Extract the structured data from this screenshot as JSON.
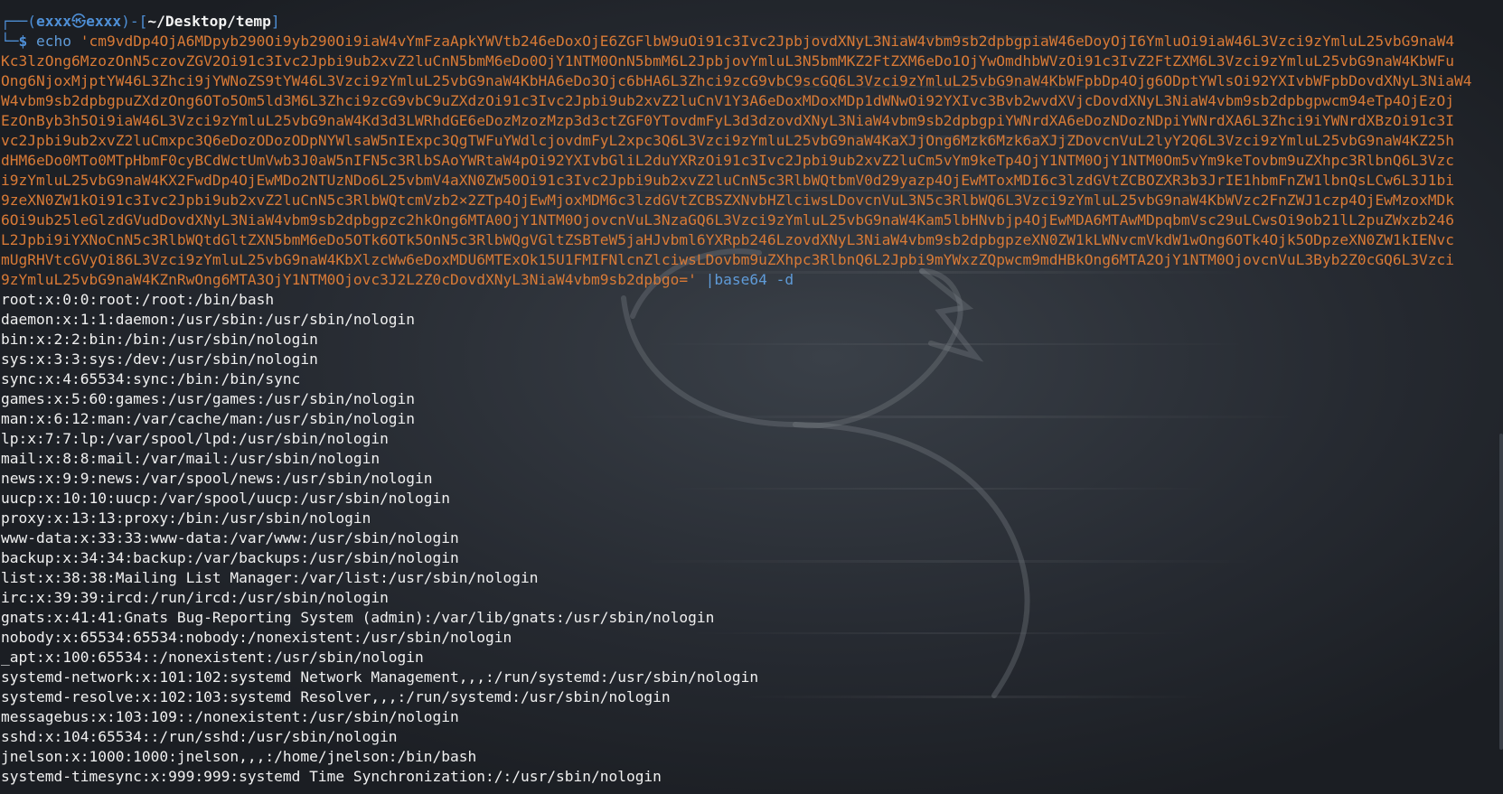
{
  "prompt": {
    "corner_top": "┌──(",
    "user": "exxx",
    "at_symbol": "㉿",
    "host": "exxx",
    "mid": ")-[",
    "cwd": "~/Desktop/temp",
    "end_bracket": "]",
    "corner_bottom": "└─",
    "dollar": "$"
  },
  "command": {
    "echo": "echo",
    "base64_lines": [
      "'cm9vdDp4OjA6MDpyb290Oi9yb290Oi9iaW4vYmFzaApkYWVtb246eDoxOjE6ZGFlbW9uOi91c3Ivc2JpbjovdXNyL3NiaW4vbm9sb2dpbgpiaW46eDoyOjI6YmluOi9iaW46L3Vzci9zYmluL25vbG9naW4",
      "Kc3lzOng6MzozOnN5czovZGV2Oi91c3Ivc2Jpbi9ub2xvZ2luCnN5bmM6eDo0OjY1NTM0OnN5bmM6L2JpbjovYmluL3N5bmMKZ2FtZXM6eDo1OjYwOmdhbWVzOi91c3IvZ2FtZXM6L3Vzci9zYmluL25vbG9naW4KbWFu",
      "Ong6NjoxMjptYW46L3Zhci9jYWNoZS9tYW46L3Vzci9zYmluL25vbG9naW4KbHA6eDo3Ojc6bHA6L3Zhci9zcG9vbC9scGQ6L3Vzci9zYmluL25vbG9naW4KbWFpbDp4Ojg6ODptYWlsOi92YXIvbWFpbDovdXNyL3NiaW4",
      "W4vbm9sb2dpbgpuZXdzOng6OTo5Om5ld3M6L3Zhci9zcG9vbC9uZXdzOi91c3Ivc2Jpbi9ub2xvZ2luCnV1Y3A6eDoxMDoxMDp1dWNwOi92YXIvc3Bvb2wvdXVjcDovdXNyL3NiaW4vbm9sb2dpbgpwcm94eTp4OjEzOj",
      "EzOnByb3h5Oi9iaW46L3Vzci9zYmluL25vbG9naW4Kd3d3LWRhdGE6eDozMzozMzp3d3ctZGF0YTovdmFyL3d3dzovdXNyL3NiaW4vbm9sb2dpbgpiYWNrdXA6eDozNDozNDpiYWNrdXA6L3Zhci9iYWNrdXBzOi91c3I",
      "vc2Jpbi9ub2xvZ2luCmxpc3Q6eDozODozODpNYWlsaW5nIExpc3QgTWFuYWdlcjovdmFyL2xpc3Q6L3Vzci9zYmluL25vbG9naW4KaXJjOng6Mzk6Mzk6aXJjZDovcnVuL2lyY2Q6L3Vzci9zYmluL25vbG9naW4KZ25h",
      "dHM6eDo0MTo0MTpHbmF0cyBCdWctUmVwb3J0aW5nIFN5c3RlbSAoYWRtaW4pOi92YXIvbGliL2duYXRzOi91c3Ivc2Jpbi9ub2xvZ2luCm5vYm9keTp4OjY1NTM0OjY1NTM0Om5vYm9keTovbm9uZXhpc3RlbnQ6L3Vzc",
      "i9zYmluL25vbG9naW4KX2FwdDp4OjEwMDo2NTUzNDo6L25vbmV4aXN0ZW50Oi91c3Ivc2Jpbi9ub2xvZ2luCnN5c3RlbWQtbmV0d29yazp4OjEwMToxMDI6c3lzdGVtZCBOZXR3b3JrIE1hbmFnZW1lbnQsLCw6L3J1bi",
      "9zeXN0ZW1kOi91c3Ivc2Jpbi9ub2xvZ2luCnN5c3RlbWQtcmVzb2×2ZTp4OjEwMjoxMDM6c3lzdGVtZCBSZXNvbHZlciwsLDovcnVuL3N5c3RlbWQ6L3Vzci9zYmluL25vbG9naW4KbWVzc2FnZWJ1czp4OjEwMzoxMDk",
      "6Oi9ub25leGlzdGVudDovdXNyL3NiaW4vbm9sb2dpbgpzc2hkOng6MTA0OjY1NTM0OjovcnVuL3NzaGQ6L3Vzci9zYmluL25vbG9naW4Kam5lbHNvbjp4OjEwMDA6MTAwMDpqbmVsc29uLCwsOi9ob21lL2puZWxzb246",
      "L2Jpbi9iYXNoCnN5c3RlbWQtdGltZXN5bmM6eDo5OTk6OTk5OnN5c3RlbWQgVGltZSBTeW5jaHJvbml6YXRpb246LzovdXNyL3NiaW4vbm9sb2dpbgpzeXN0ZW1kLWNvcmVkdW1wOng6OTk4Ojk5ODpzeXN0ZW1kIENvc",
      "mUgRHVtcGVyOi86L3Vzci9zYmluL25vbG9naW4KbXlzcWw6eDoxMDU6MTExOk15U1FMIFNlcnZlciwsLDovbm9uZXhpc3RlbnQ6L2Jpbi9mYWxzZQpwcm9mdHBkOng6MTA2OjY1NTM0OjovcnVuL3Byb2Z0cGQ6L3Vzci",
      "9zYmluL25vbG9naW4KZnRwOng6MTA3OjY1NTM0Ojovc3J2L2Z0cDovdXNyL3NiaW4vbm9sb2dpbgo='"
    ],
    "pipe": "|base64",
    "flag": "-d"
  },
  "output_lines": [
    "root:x:0:0:root:/root:/bin/bash",
    "daemon:x:1:1:daemon:/usr/sbin:/usr/sbin/nologin",
    "bin:x:2:2:bin:/bin:/usr/sbin/nologin",
    "sys:x:3:3:sys:/dev:/usr/sbin/nologin",
    "sync:x:4:65534:sync:/bin:/bin/sync",
    "games:x:5:60:games:/usr/games:/usr/sbin/nologin",
    "man:x:6:12:man:/var/cache/man:/usr/sbin/nologin",
    "lp:x:7:7:lp:/var/spool/lpd:/usr/sbin/nologin",
    "mail:x:8:8:mail:/var/mail:/usr/sbin/nologin",
    "news:x:9:9:news:/var/spool/news:/usr/sbin/nologin",
    "uucp:x:10:10:uucp:/var/spool/uucp:/usr/sbin/nologin",
    "proxy:x:13:13:proxy:/bin:/usr/sbin/nologin",
    "www-data:x:33:33:www-data:/var/www:/usr/sbin/nologin",
    "backup:x:34:34:backup:/var/backups:/usr/sbin/nologin",
    "list:x:38:38:Mailing List Manager:/var/list:/usr/sbin/nologin",
    "irc:x:39:39:ircd:/run/ircd:/usr/sbin/nologin",
    "gnats:x:41:41:Gnats Bug-Reporting System (admin):/var/lib/gnats:/usr/sbin/nologin",
    "nobody:x:65534:65534:nobody:/nonexistent:/usr/sbin/nologin",
    "_apt:x:100:65534::/nonexistent:/usr/sbin/nologin",
    "systemd-network:x:101:102:systemd Network Management,,,:/run/systemd:/usr/sbin/nologin",
    "systemd-resolve:x:102:103:systemd Resolver,,,:/run/systemd:/usr/sbin/nologin",
    "messagebus:x:103:109::/nonexistent:/usr/sbin/nologin",
    "sshd:x:104:65534::/run/sshd:/usr/sbin/nologin",
    "jnelson:x:1000:1000:jnelson,,,:/home/jnelson:/bin/bash",
    "systemd-timesync:x:999:999:systemd Time Synchronization:/:/usr/sbin/nologin"
  ],
  "colors": {
    "background": "#1e2127",
    "prompt_blue": "#4e8fd6",
    "string_orange": "#d97a36",
    "text": "#f0f0f0"
  }
}
